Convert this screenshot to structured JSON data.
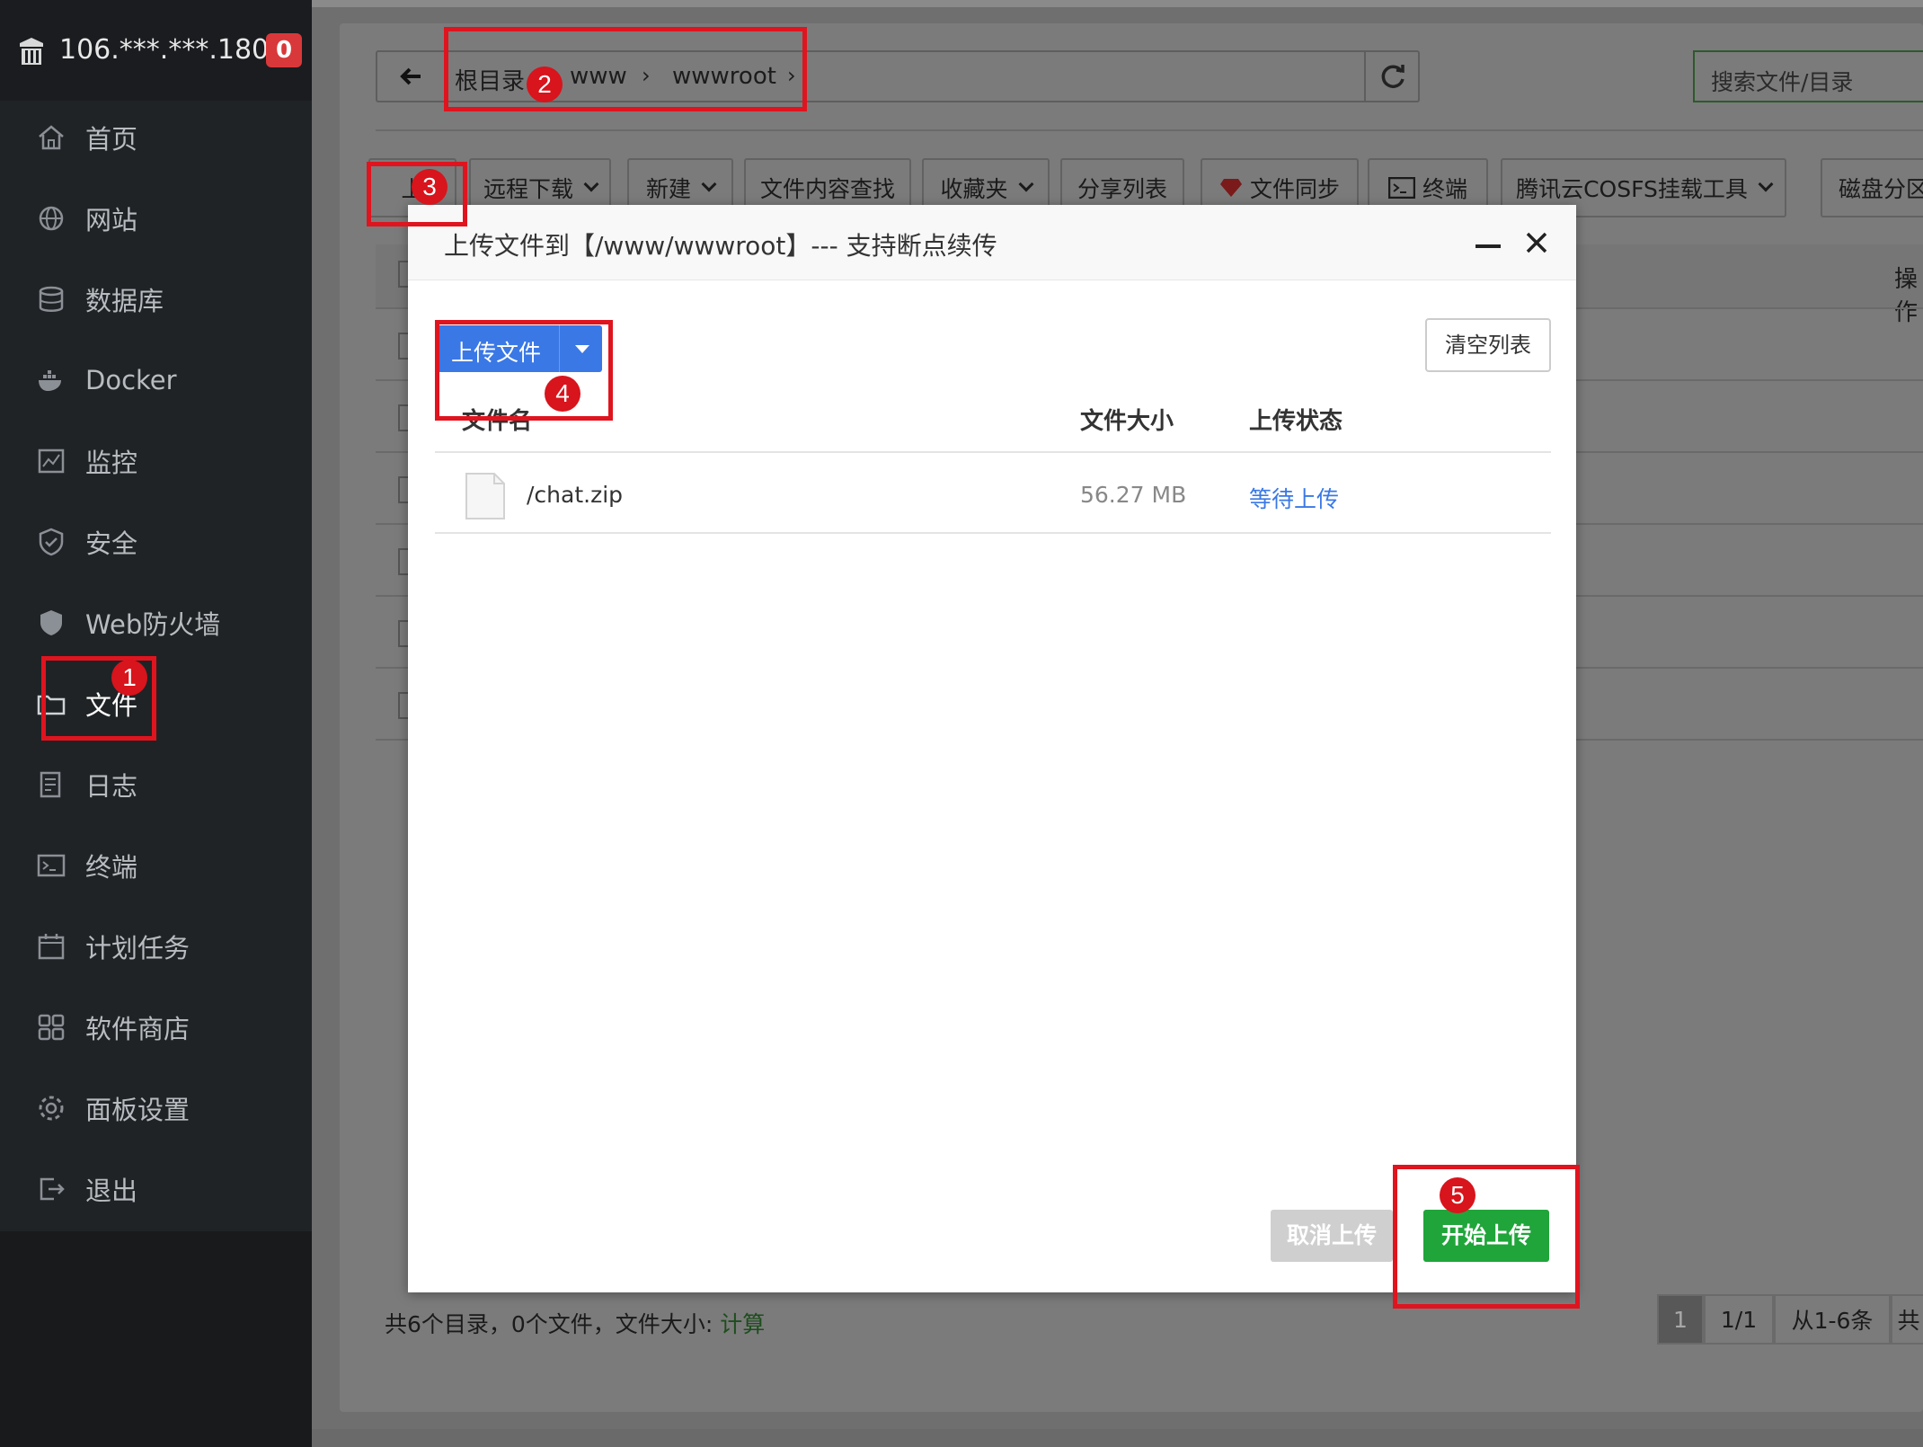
{
  "sidebar": {
    "server_ip": "106.***.***.180",
    "alert_count": "0",
    "items": [
      {
        "label": "首页",
        "icon": "home-icon"
      },
      {
        "label": "网站",
        "icon": "globe-icon"
      },
      {
        "label": "数据库",
        "icon": "database-icon"
      },
      {
        "label": "Docker",
        "icon": "docker-icon"
      },
      {
        "label": "监控",
        "icon": "monitor-icon"
      },
      {
        "label": "安全",
        "icon": "shield-icon"
      },
      {
        "label": "Web防火墙",
        "icon": "firewall-icon"
      },
      {
        "label": "文件",
        "icon": "folder-icon"
      },
      {
        "label": "日志",
        "icon": "log-icon"
      },
      {
        "label": "终端",
        "icon": "terminal-icon"
      },
      {
        "label": "计划任务",
        "icon": "calendar-icon"
      },
      {
        "label": "软件商店",
        "icon": "grid-icon"
      },
      {
        "label": "面板设置",
        "icon": "gear-icon"
      },
      {
        "label": "退出",
        "icon": "logout-icon"
      }
    ],
    "active_index": 7
  },
  "path": {
    "crumbs": [
      "根目录",
      "www",
      "wwwroot"
    ]
  },
  "search": {
    "placeholder": "搜索文件/目录"
  },
  "toolbar": {
    "upload_label": "上",
    "remote_download": "远程下载",
    "new": "新建",
    "content_search": "文件内容查找",
    "favorites": "收藏夹",
    "share_list": "分享列表",
    "file_sync": "文件同步",
    "terminal": "终端",
    "cosfs": "腾讯云COSFS挂载工具",
    "disk": "磁盘分区"
  },
  "list": {
    "ops_header": "操作"
  },
  "footer": {
    "summary": "共6个目录，0个文件，文件大小: ",
    "calc_link": "计算",
    "pager": {
      "current": "1",
      "pages": "1/1",
      "range": "从1-6条",
      "total": "共"
    }
  },
  "modal": {
    "title": "上传文件到【/www/wwwroot】--- 支持断点续传",
    "upload_button": "上传文件",
    "clear_button": "清空列表",
    "columns": {
      "name": "文件名",
      "size": "文件大小",
      "status": "上传状态"
    },
    "files": [
      {
        "name": "/chat.zip",
        "size": "56.27 MB",
        "status": "等待上传"
      }
    ],
    "cancel_button": "取消上传",
    "start_button": "开始上传"
  },
  "annotations": [
    "1",
    "2",
    "3",
    "4",
    "5"
  ],
  "colors": {
    "sidebar_bg": "#202326",
    "badge_red": "#d9383a",
    "primary_blue": "#3a78e6",
    "start_green": "#20a53a",
    "status_blue": "#3a78e6",
    "annotation_red": "#e0141e"
  }
}
